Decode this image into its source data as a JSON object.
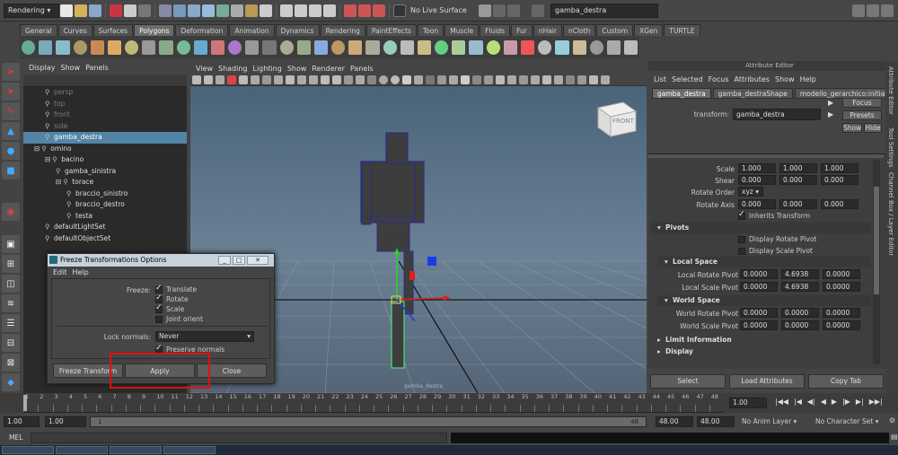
{
  "statusline": {
    "menuset": "Rendering",
    "live_surface": "No Live Surface",
    "name_field": "gamba_destra"
  },
  "shelf_tabs": [
    "General",
    "Curves",
    "Surfaces",
    "Polygons",
    "Deformation",
    "Animation",
    "Dynamics",
    "Rendering",
    "PaintEffects",
    "Toon",
    "Muscle",
    "Fluids",
    "Fur",
    "nHair",
    "nCloth",
    "Custom",
    "XGen",
    "TURTLE"
  ],
  "shelf_active": "Polygons",
  "outliner": {
    "menu": [
      "Display",
      "Show",
      "Panels"
    ],
    "items": [
      {
        "label": "persp",
        "indent": 2,
        "style": "dim"
      },
      {
        "label": "top",
        "indent": 2,
        "style": "dim"
      },
      {
        "label": "front",
        "indent": 2,
        "style": "dim"
      },
      {
        "label": "side",
        "indent": 2,
        "style": "dim"
      },
      {
        "label": "gamba_destra",
        "indent": 2,
        "style": "sel"
      },
      {
        "label": "omino",
        "indent": 1,
        "style": "",
        "exp": "⊟"
      },
      {
        "label": "bacino",
        "indent": 2,
        "style": "",
        "exp": "⊟"
      },
      {
        "label": "gamba_sinistra",
        "indent": 3,
        "style": ""
      },
      {
        "label": "torace",
        "indent": 3,
        "style": "",
        "exp": "⊟"
      },
      {
        "label": "braccio_sinistro",
        "indent": 4,
        "style": ""
      },
      {
        "label": "braccio_destro",
        "indent": 4,
        "style": ""
      },
      {
        "label": "testa",
        "indent": 4,
        "style": ""
      },
      {
        "label": "defaultLightSet",
        "indent": 2,
        "style": ""
      },
      {
        "label": "defaultObjectSet",
        "indent": 2,
        "style": ""
      }
    ]
  },
  "viewport": {
    "menu": [
      "View",
      "Shading",
      "Lighting",
      "Show",
      "Renderer",
      "Panels"
    ],
    "viewcube": "FRONT",
    "hud": "gamba_destra"
  },
  "ae": {
    "title": "Attribute Editor",
    "menu": [
      "List",
      "Selected",
      "Focus",
      "Attributes",
      "Show",
      "Help"
    ],
    "tabs": [
      "gamba_destra",
      "gamba_destraShape",
      "modello_gerarchico:initialShading"
    ],
    "transform_label": "transform:",
    "transform_value": "gamba_destra",
    "focus": "Focus",
    "presets": "Presets",
    "show": "Show",
    "hide": "Hide",
    "rows": [
      {
        "label": "Scale",
        "v": [
          "1.000",
          "1.000",
          "1.000"
        ]
      },
      {
        "label": "Shear",
        "v": [
          "0.000",
          "0.000",
          "0.000"
        ]
      }
    ],
    "rotate_order_label": "Rotate Order",
    "rotate_order": "xyz",
    "rotate_axis_label": "Rotate Axis",
    "rotate_axis": [
      "0.000",
      "0.000",
      "0.000"
    ],
    "inherits": "Inherits Transform",
    "pivots": "Pivots",
    "disp_rot_pivot": "Display Rotate Pivot",
    "disp_scale_pivot": "Display Scale Pivot",
    "local_space": "Local Space",
    "local_rot_pivot_label": "Local Rotate Pivot",
    "local_rot_pivot": [
      "0.0000",
      "4.6938",
      "0.0000"
    ],
    "local_scale_pivot_label": "Local Scale Pivot",
    "local_scale_pivot": [
      "0.0000",
      "4.6938",
      "0.0000"
    ],
    "world_space": "World Space",
    "world_rot_pivot_label": "World Rotate Pivot",
    "world_rot_pivot": [
      "0.0000",
      "0.0000",
      "0.0000"
    ],
    "world_scale_pivot_label": "World Scale Pivot",
    "world_scale_pivot": [
      "0.0000",
      "0.0000",
      "0.0000"
    ],
    "limit_info": "Limit Information",
    "display": "Display",
    "select": "Select",
    "load": "Load Attributes",
    "copy": "Copy Tab"
  },
  "vtabs": [
    "Attribute Editor",
    "Tool Settings",
    "Channel Box / Layer Editor"
  ],
  "dialog": {
    "title": "Freeze Transformations Options",
    "menu": [
      "Edit",
      "Help"
    ],
    "freeze_label": "Freeze:",
    "translate": "Translate",
    "rotate": "Rotate",
    "scale": "Scale",
    "joint_orient": "Joint orient",
    "lock_normals_label": "Lock normals:",
    "lock_normals_value": "Never",
    "preserve_normals": "Preserve normals",
    "btn_freeze": "Freeze Transform",
    "btn_apply": "Apply",
    "btn_close": "Close"
  },
  "timeline": {
    "ticks": [
      "1",
      "2",
      "3",
      "4",
      "5",
      "6",
      "7",
      "8",
      "9",
      "10",
      "11",
      "12",
      "13",
      "14",
      "15",
      "16",
      "17",
      "18",
      "19",
      "20",
      "21",
      "22",
      "23",
      "24",
      "25",
      "26",
      "27",
      "28",
      "29",
      "30",
      "31",
      "32",
      "33",
      "34",
      "35",
      "36",
      "37",
      "38",
      "39",
      "40",
      "41",
      "42",
      "43",
      "44",
      "45",
      "46",
      "47",
      "48"
    ],
    "current": "1.00"
  },
  "range": {
    "start": "1.00",
    "inner_start": "1.00",
    "slider_start": "1",
    "slider_end": "48",
    "inner_end": "48.00",
    "end": "48.00",
    "anim_layer": "No Anim Layer",
    "char_set": "No Character Set"
  },
  "cmdline": {
    "label": "MEL"
  },
  "colors": {
    "selection": "#5285a6",
    "highlight_box": "#e01010"
  }
}
